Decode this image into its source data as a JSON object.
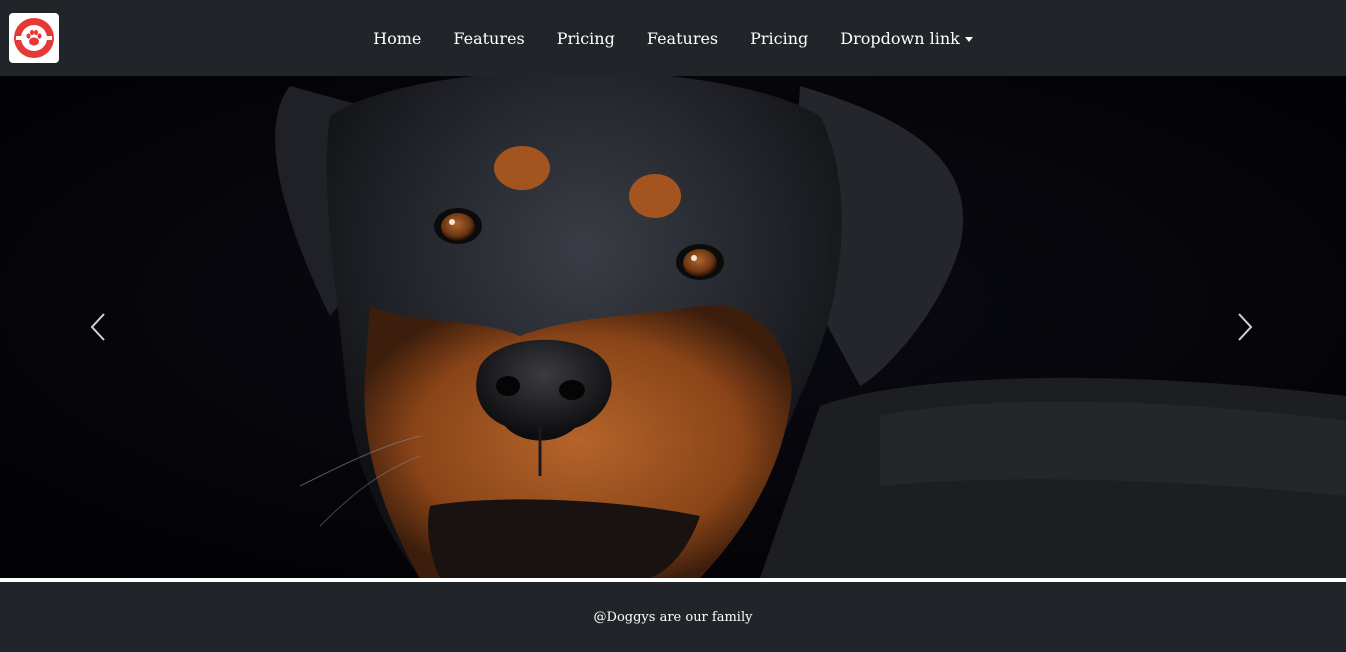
{
  "brand": {
    "logo_icon": "paw-icon",
    "accent": "#e53935"
  },
  "nav": {
    "items": [
      {
        "label": "Home"
      },
      {
        "label": "Features"
      },
      {
        "label": "Pricing"
      },
      {
        "label": "Features"
      },
      {
        "label": "Pricing"
      }
    ],
    "dropdown_label": "Dropdown link"
  },
  "carousel": {
    "prev_icon": "chevron-left-icon",
    "next_icon": "chevron-right-icon"
  },
  "footer": {
    "text": "@Doggys are our family"
  },
  "colors": {
    "navbar_bg": "#212529",
    "footer_bg": "#212529"
  }
}
